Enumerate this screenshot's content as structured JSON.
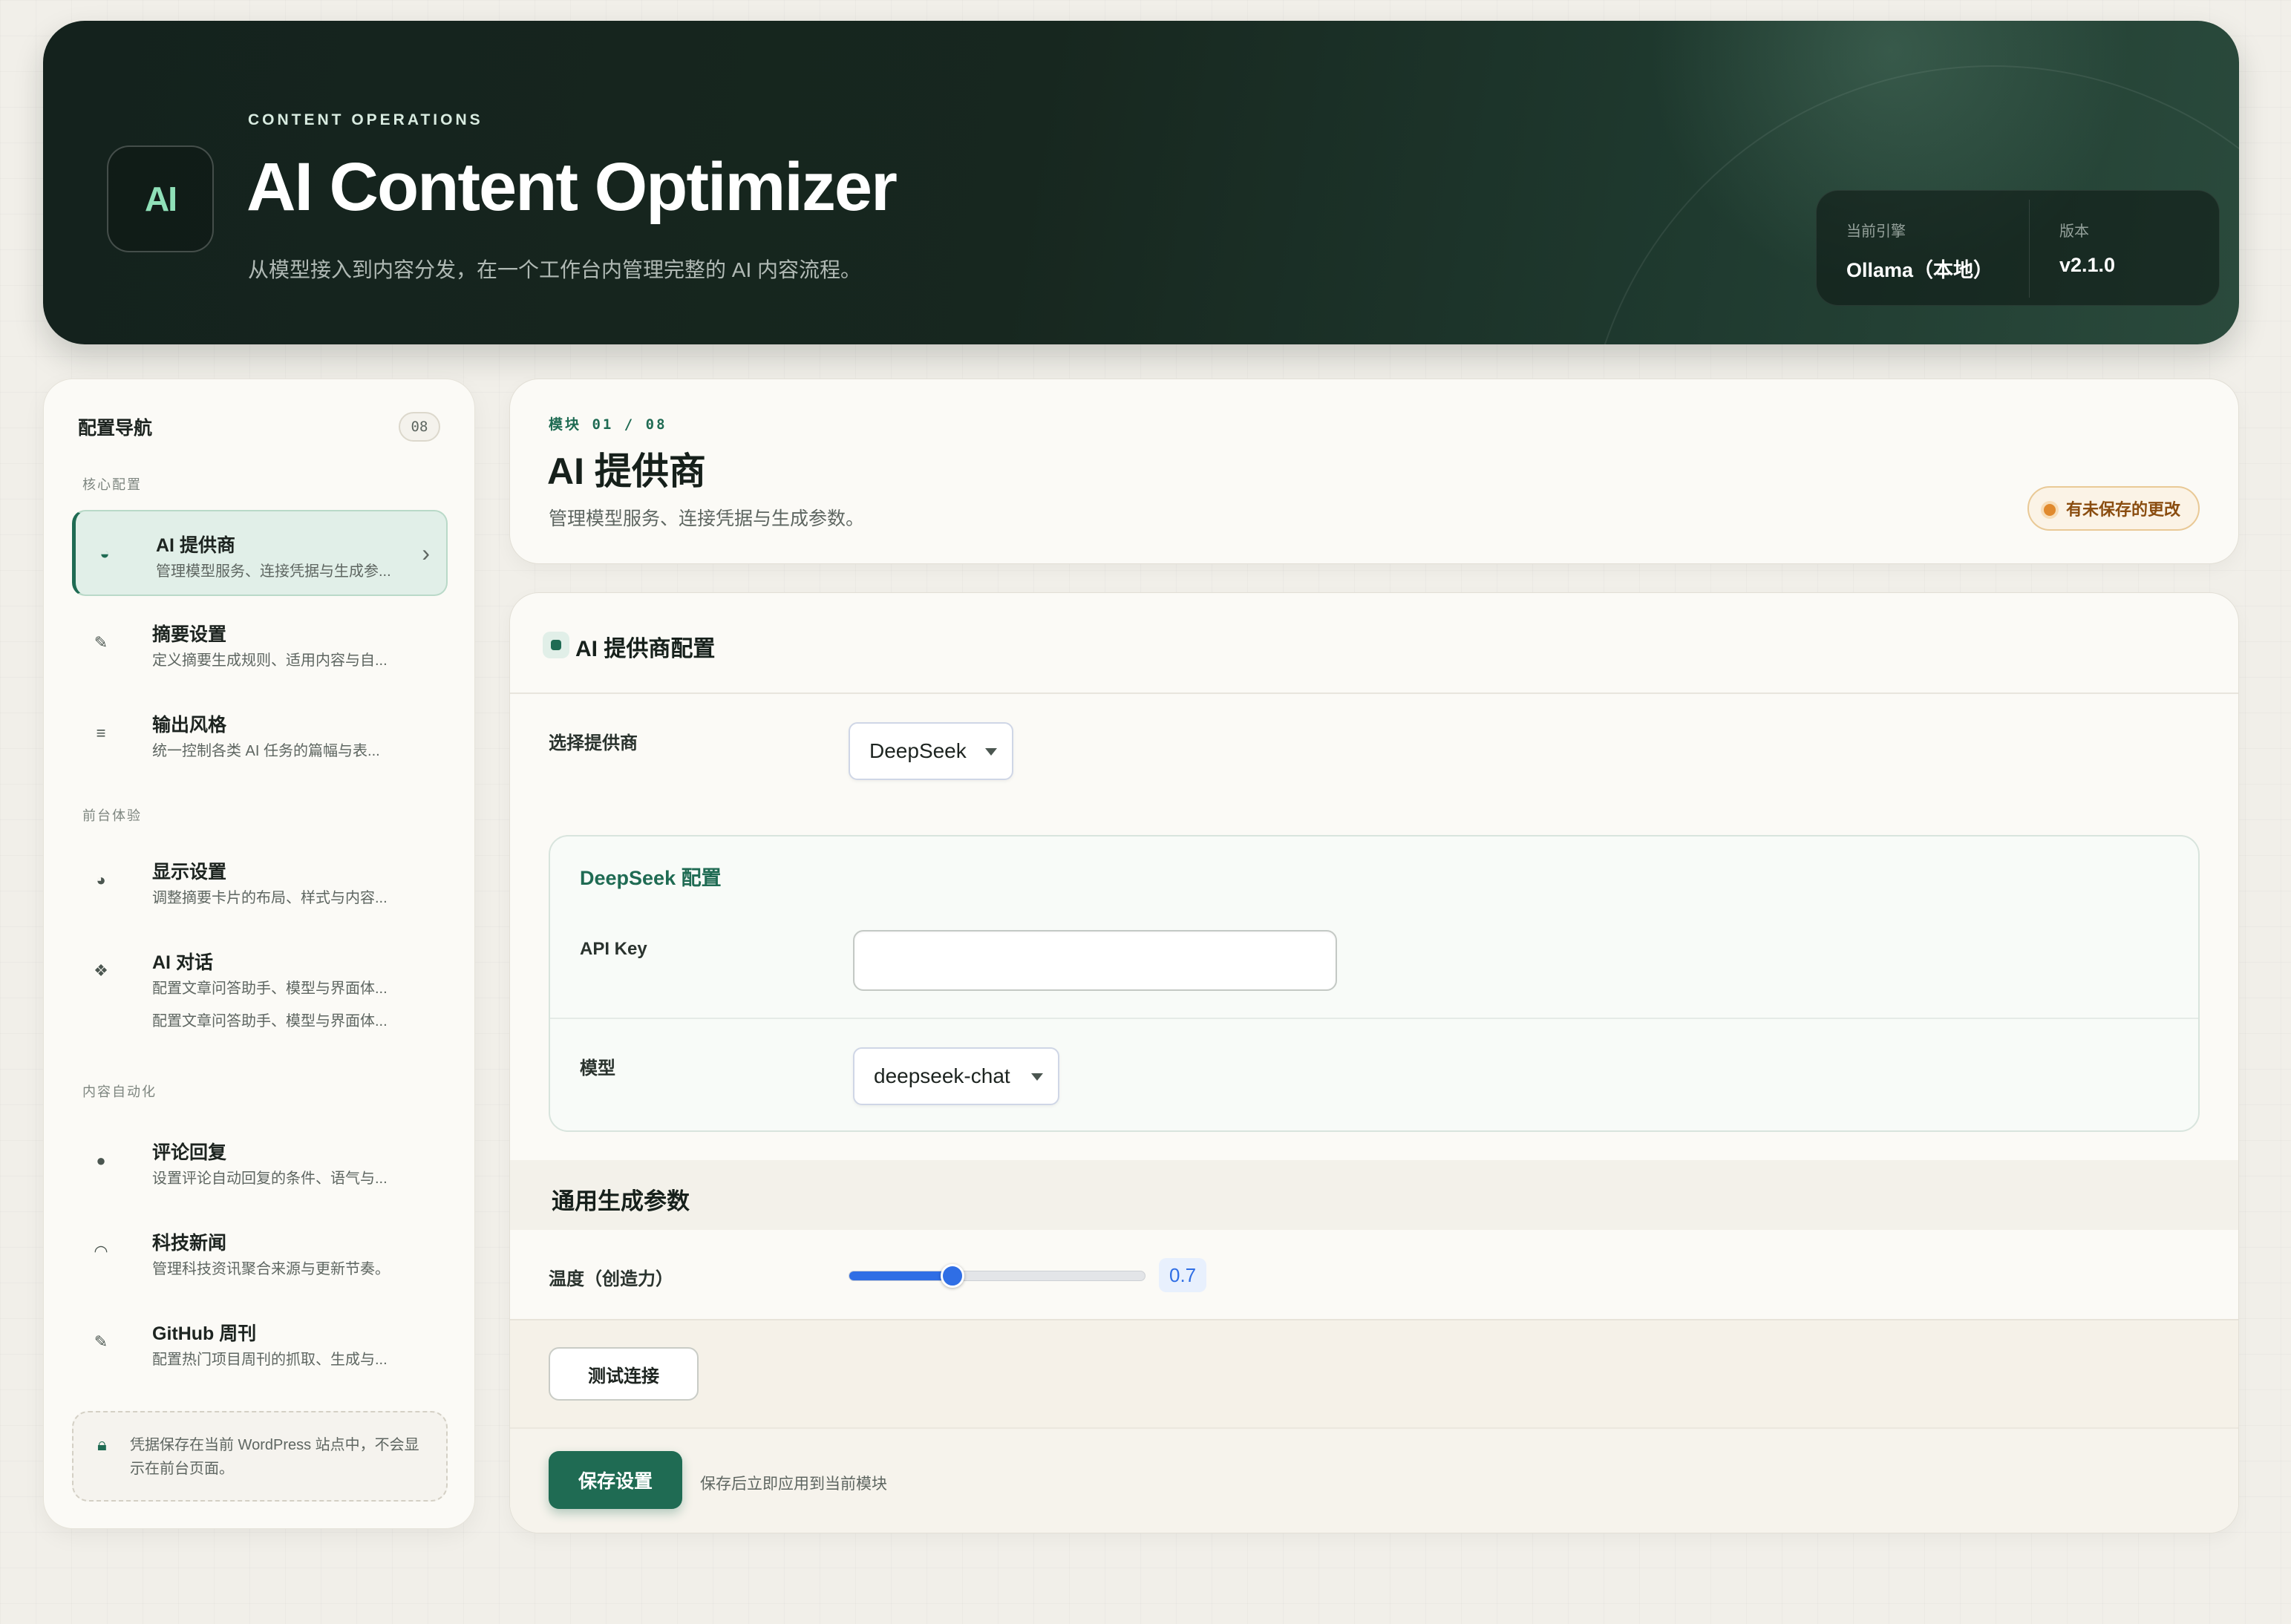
{
  "hero": {
    "logo": "AI",
    "eyebrow": "CONTENT OPERATIONS",
    "title": "AI Content Optimizer",
    "subtitle": "从模型接入到内容分发，在一个工作台内管理完整的 AI 内容流程。",
    "stats": [
      {
        "label": "当前引擎",
        "value": "Ollama（本地）"
      },
      {
        "label": "版本",
        "value": "v2.1.0"
      }
    ]
  },
  "sidebar": {
    "title": "配置导航",
    "count": "08",
    "groups": [
      "核心配置",
      "前台体验",
      "内容自动化"
    ],
    "items": [
      {
        "name": "AI 提供商",
        "desc": "管理模型服务、连接凭据与生成参...",
        "icon": "provider-icon",
        "active": true
      },
      {
        "name": "摘要设置",
        "desc": "定义摘要生成规则、适用内容与自...",
        "icon": "edit-icon"
      },
      {
        "name": "输出风格",
        "desc": "统一控制各类 AI 任务的篇幅与表...",
        "icon": "list-icon"
      },
      {
        "name": "显示设置",
        "desc": "调整摘要卡片的布局、样式与内容...",
        "icon": "palette-icon"
      },
      {
        "name": "AI 对话",
        "desc": "配置文章问答助手、模型与界面体...",
        "extra": "配置文章问答助手、模型与界面体...",
        "icon": "chat-icon"
      },
      {
        "name": "评论回复",
        "desc": "设置评论自动回复的条件、语气与...",
        "icon": "comment-icon"
      },
      {
        "name": "科技新闻",
        "desc": "管理科技资讯聚合来源与更新节奏。",
        "icon": "rss-icon"
      },
      {
        "name": "GitHub 周刊",
        "desc": "配置热门项目周刊的抓取、生成与...",
        "icon": "edit-icon"
      }
    ],
    "note": "凭据保存在当前 WordPress 站点中，不会显示在前台页面。"
  },
  "module": {
    "label": "模块 01 / 08",
    "title": "AI 提供商",
    "desc": "管理模型服务、连接凭据与生成参数。",
    "unsaved": "有未保存的更改"
  },
  "config": {
    "title": "AI 提供商配置",
    "provider_label": "选择提供商",
    "provider_value": "DeepSeek",
    "box_title": "DeepSeek 配置",
    "api_key_label": "API Key",
    "api_key_value": "",
    "model_label": "模型",
    "model_value": "deepseek-chat",
    "general_title": "通用生成参数",
    "temperature_label": "温度（创造力）",
    "temperature_value": "0.7",
    "temperature_fraction": 0.35,
    "test_button": "测试连接",
    "save_button": "保存设置",
    "save_note": "保存后立即应用到当前模块"
  },
  "colors": {
    "accent": "#1f6b53",
    "slider": "#2f6ee5",
    "warning": "#e08a2e"
  }
}
